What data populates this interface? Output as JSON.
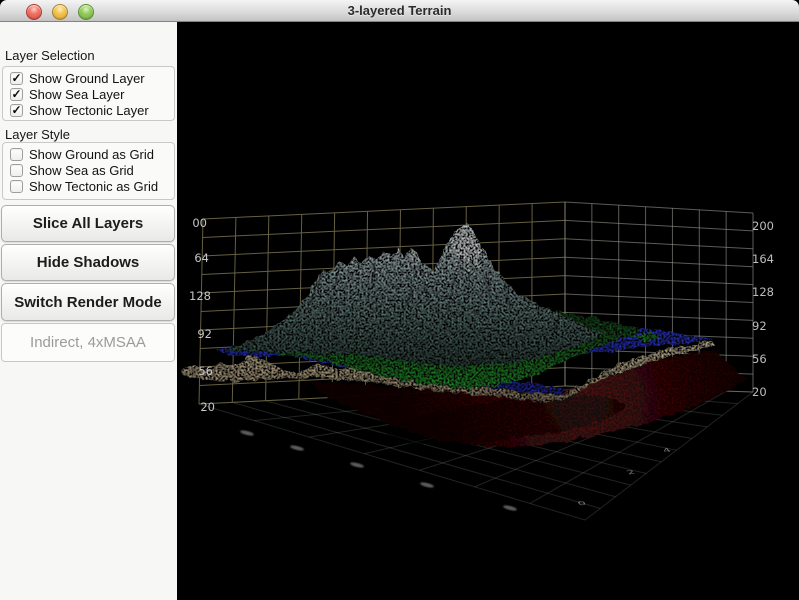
{
  "window": {
    "title": "3-layered Terrain",
    "controls": [
      "close",
      "minimize",
      "zoom"
    ]
  },
  "glyphs": {
    "check": "✓"
  },
  "sidebar": {
    "layer_selection": {
      "label": "Layer Selection",
      "items": [
        {
          "label": "Show Ground Layer",
          "checked": true
        },
        {
          "label": "Show Sea Layer",
          "checked": true
        },
        {
          "label": "Show Tectonic Layer",
          "checked": true
        }
      ]
    },
    "layer_style": {
      "label": "Layer Style",
      "items": [
        {
          "label": "Show Ground as Grid",
          "checked": false
        },
        {
          "label": "Show Sea as Grid",
          "checked": false
        },
        {
          "label": "Show Tectonic as Grid",
          "checked": false
        }
      ]
    },
    "buttons": [
      "Slice All Layers",
      "Hide Shadows",
      "Switch Render Mode"
    ],
    "status": "Indirect, 4xMSAA"
  },
  "viewport": {
    "left_axis_labels": [
      "00",
      "64",
      "128",
      "92",
      "56",
      "20"
    ],
    "right_axis_labels": [
      "200",
      "164",
      "128",
      "92",
      "56",
      "20"
    ],
    "floor_tick_labels": [
      "0",
      "2",
      "4"
    ],
    "colors": {
      "background": "#000000",
      "sea_blue": "#2a36d2",
      "ground_green": "#1f9328",
      "mountain_gray": "#a9bcbd",
      "snow_white": "#f2f7f7",
      "sand_tan": "#cdbb98",
      "tectonic_red": "#5c0707",
      "grid_left_wall": "#6a6446",
      "grid_right_wall": "#98988f",
      "grid_floor": "#8fa392",
      "axis_text": "#c6c6c6"
    }
  }
}
